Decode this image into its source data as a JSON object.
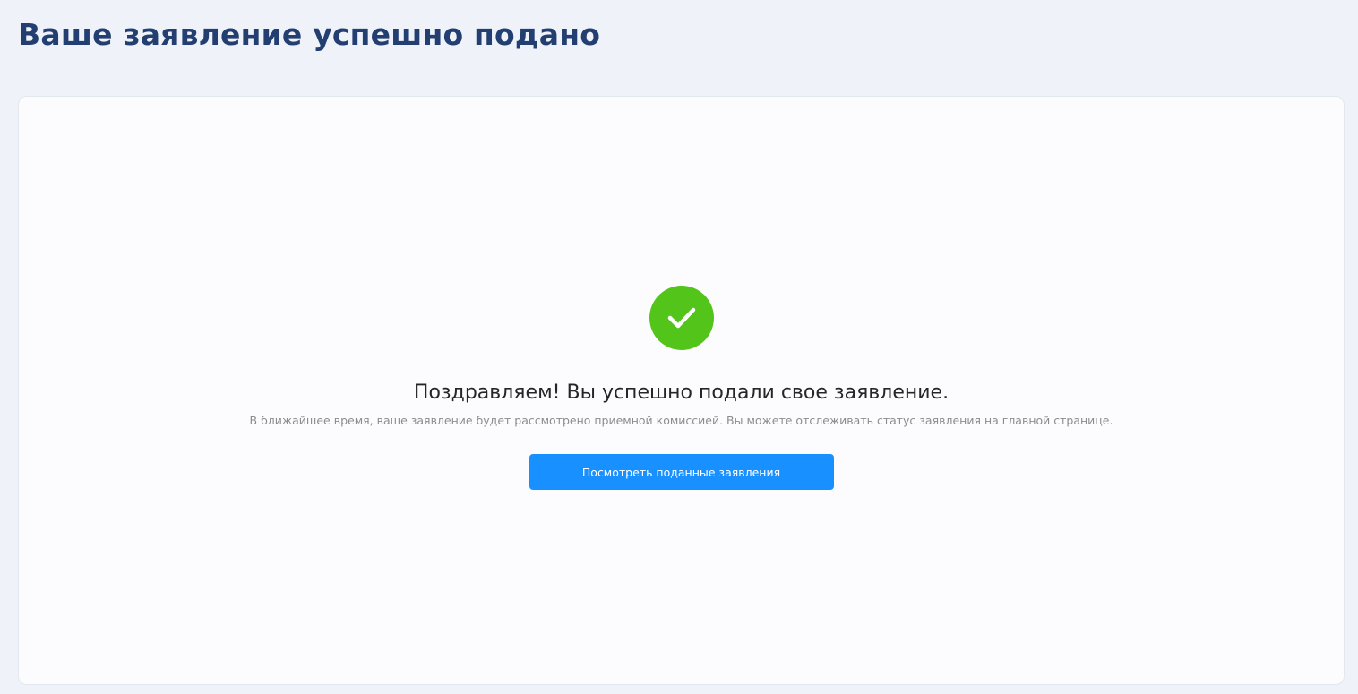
{
  "header": {
    "title": "Ваше заявление успешно подано"
  },
  "result": {
    "status": "success",
    "icon": "check-icon",
    "title": "Поздравляем! Вы успешно подали свое заявление.",
    "subtitle": "В ближайшее время, ваше заявление будет рассмотрено приемной комиссией. Вы можете отслеживать статус заявления на главной странице.",
    "button_label": "Посмотреть поданные заявления"
  },
  "colors": {
    "title": "#233f72",
    "success": "#52c41a",
    "primary": "#1890ff",
    "background": "#eff3f9",
    "card": "#fcfcfe"
  }
}
